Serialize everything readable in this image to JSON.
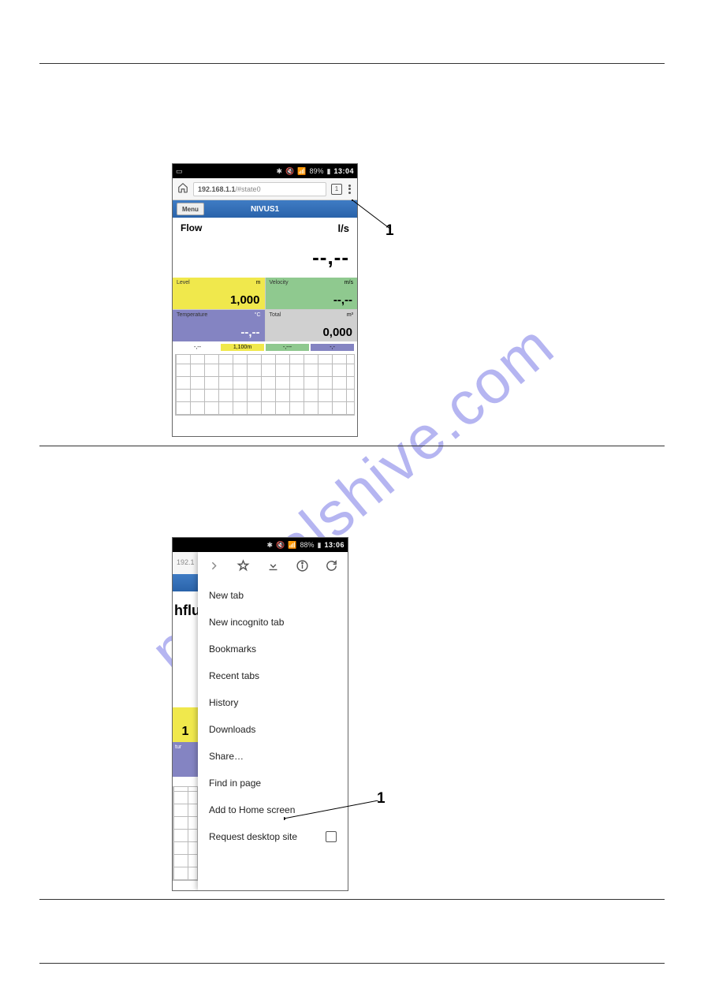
{
  "hr_positions": [],
  "watermark": "manualshive.com",
  "phone1": {
    "status": {
      "battery": "89%",
      "time": "13:04"
    },
    "url": {
      "prefix": "192.168.1.1",
      "suffix": "/#state0"
    },
    "tab_count": "1",
    "menu_btn": "Menu",
    "app_title": "NIVUS1",
    "flow": {
      "label": "Flow",
      "unit": "l/s",
      "value": "--,--"
    },
    "tiles": {
      "level": {
        "label": "Level",
        "unit": "m",
        "value": "1,000"
      },
      "velocity": {
        "label": "Velocity",
        "unit": "m/s",
        "value": "--,--"
      },
      "temperature": {
        "label": "Temperature",
        "unit": "°C",
        "value": "--,--"
      },
      "total": {
        "label": "Total",
        "unit": "m³",
        "value": "0,000"
      }
    },
    "seg": {
      "a": "-,--",
      "b": "1,100m",
      "c": "-,---",
      "d": "-,-"
    }
  },
  "callout1": "1",
  "phone2": {
    "status": {
      "battery": "88%",
      "time": "13:06"
    },
    "url_visible": "192.1",
    "bg_text": "hflu",
    "bg_num": "1",
    "bg_tur": "tur",
    "menu": {
      "items": [
        "New tab",
        "New incognito tab",
        "Bookmarks",
        "Recent tabs",
        "History",
        "Downloads",
        "Share…",
        "Find in page",
        "Add to Home screen",
        "Request desktop site"
      ]
    }
  },
  "callout2": "1"
}
